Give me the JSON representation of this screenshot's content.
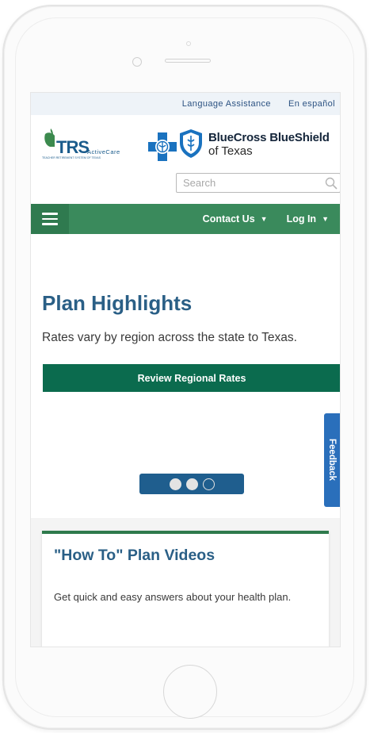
{
  "topbar": {
    "language_assistance": "Language Assistance",
    "espanol": "En español"
  },
  "logos": {
    "trs_name": "TRS",
    "trs_sub": "ActiveCare",
    "trs_tagline": "TEACHER RETIREMENT SYSTEM OF TEXAS",
    "bcbs_name": "BlueCross BlueShield",
    "bcbs_sub": "of Texas"
  },
  "search": {
    "placeholder": "Search"
  },
  "nav": {
    "contact_us": "Contact Us",
    "log_in": "Log In"
  },
  "hero": {
    "title": "Plan Highlights",
    "text": "Rates vary by region across the state to Texas.",
    "button_label": "Review Regional Rates",
    "carousel_total": 3,
    "carousel_active": 3
  },
  "feedback": {
    "label": "Feedback"
  },
  "howto": {
    "title": "\"How To\" Plan Videos",
    "text": "Get quick and easy answers about your health plan."
  },
  "colors": {
    "nav_green": "#3a8a5c",
    "button_green": "#0b6b4e",
    "heading_blue": "#2a5f86",
    "feedback_blue": "#2a6fbb",
    "dots_bg": "#1f5e8e"
  }
}
